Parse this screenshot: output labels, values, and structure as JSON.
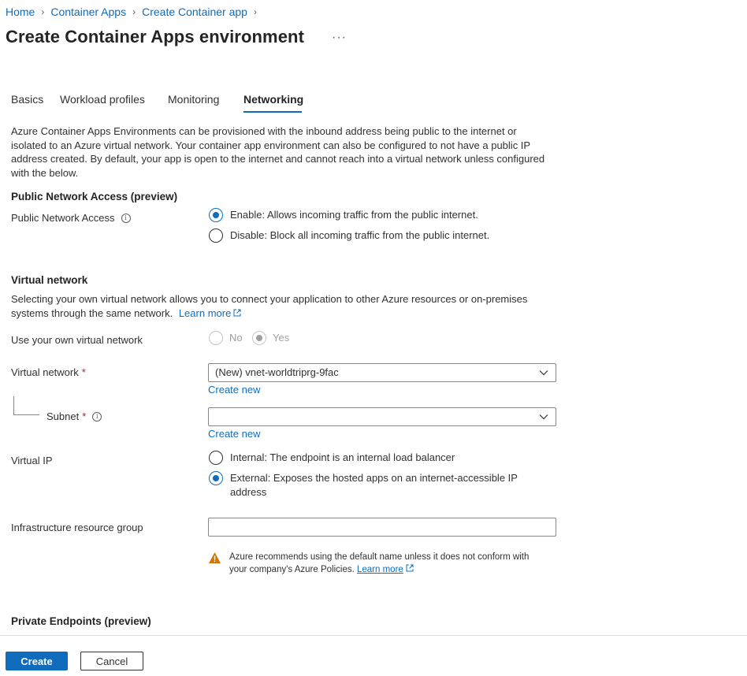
{
  "breadcrumb": {
    "items": [
      "Home",
      "Container Apps",
      "Create Container app"
    ]
  },
  "page": {
    "title": "Create Container Apps environment",
    "more": "···"
  },
  "tabs": [
    "Basics",
    "Workload profiles",
    "Monitoring",
    "Networking"
  ],
  "active_tab": "Networking",
  "intro": {
    "line1": "Azure Container Apps Environments can be provisioned with the inbound address being public to the internet or",
    "line2": "isolated to an Azure virtual network. Your container app environment can also be configured to not have a public IP",
    "line3": "address created. By default, your app is open to the internet and cannot reach into a virtual network unless configured",
    "line4": "with the below."
  },
  "public_access": {
    "heading": "Public Network Access (preview)",
    "label": "Public Network Access",
    "options": [
      {
        "text": "Enable: Allows incoming traffic from the public internet.",
        "checked": true
      },
      {
        "text": "Disable: Block all incoming traffic from the public internet.",
        "checked": false
      }
    ]
  },
  "vnet_section": {
    "heading": "Virtual network",
    "desc_line1": "Selecting your own virtual network allows you to connect your application to other Azure resources or on-premises",
    "desc_line2": "systems through the same network.",
    "learn_more": "Learn more",
    "own_vnet_label": "Use your own virtual network",
    "own_vnet_options": [
      {
        "text": "No",
        "checked": false
      },
      {
        "text": "Yes",
        "checked": true
      }
    ],
    "vnet_label": "Virtual network",
    "vnet_value": "(New) vnet-worldtriprg-9fac",
    "create_new": "Create new",
    "subnet_label": "Subnet",
    "subnet_value": "",
    "subnet_create_new": "Create new",
    "required_mark": "*",
    "vip_label": "Virtual IP",
    "vip_options": [
      {
        "text": "Internal: The endpoint is an internal load balancer",
        "checked": false
      },
      {
        "text_line1": "External: Exposes the hosted apps on an internet-accessible IP",
        "text_line2": "address",
        "checked": true
      }
    ],
    "infra_rg_label": "Infrastructure resource group",
    "infra_rg_value": "",
    "warning_line1": "Azure recommends using the default name unless it does not conform with",
    "warning_line2": "your company's Azure Policies.",
    "warning_link": "Learn more"
  },
  "private_endpoints": {
    "heading": "Private Endpoints (preview)"
  },
  "footer": {
    "create_label": "Create",
    "cancel_label": "Cancel"
  },
  "colors": {
    "accent": "#0f6cbd",
    "warning": "#d47500",
    "required": "#a4262c"
  }
}
